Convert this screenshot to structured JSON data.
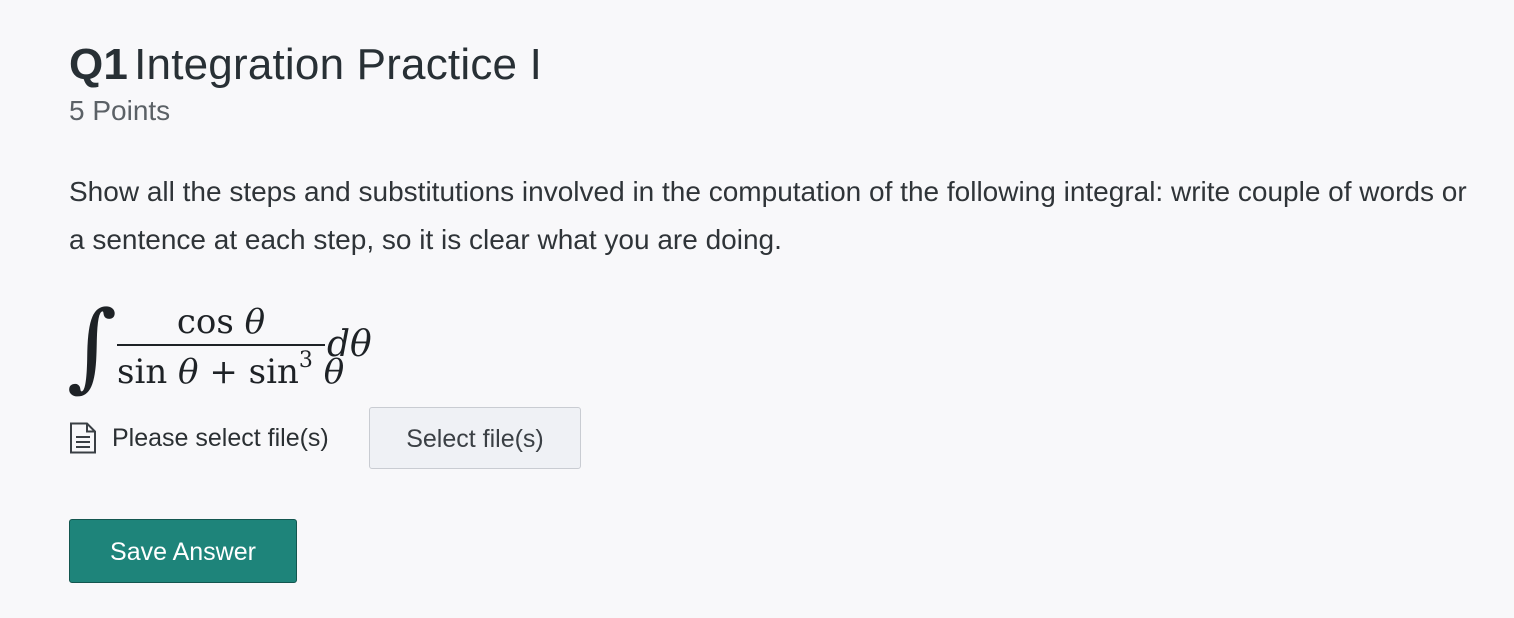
{
  "question": {
    "number": "Q1",
    "title": "Integration Practice I",
    "points": "5 Points",
    "prompt": "Show all the steps and substitutions involved in the computation of the following integral: write couple of words or a sentence at each step, so it is clear what you are doing.",
    "integral": {
      "symbol": "∫",
      "numerator_fn": "cos",
      "variable": "θ",
      "denominator_fn1": "sin",
      "plus": "+",
      "denominator_fn2": "sin",
      "exponent": "3",
      "differential": "dθ"
    }
  },
  "upload": {
    "icon": "file-document-icon",
    "status_text": "Please select file(s)",
    "select_button_label": "Select file(s)"
  },
  "actions": {
    "save_label": "Save Answer",
    "save_color": "#1e847a"
  }
}
